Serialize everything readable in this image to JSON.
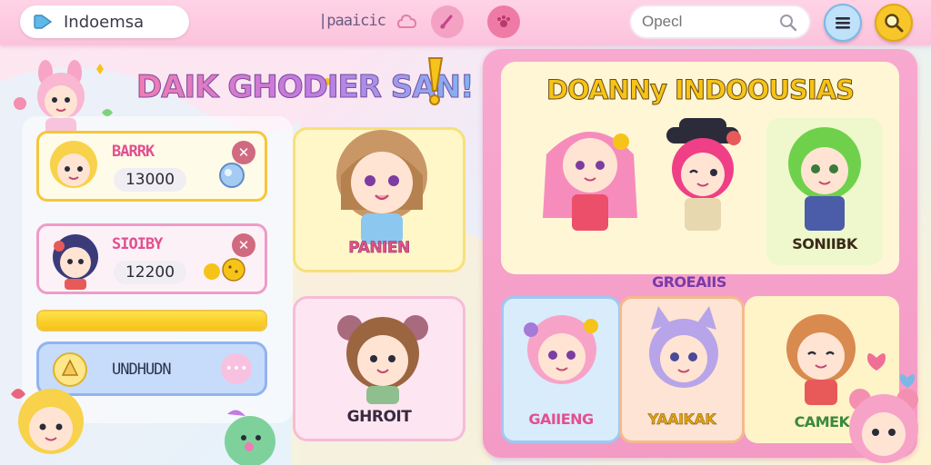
{
  "header": {
    "app_title": "Indoemsa",
    "nav_label": "|paaicic",
    "search_placeholder": "Opecl"
  },
  "left": {
    "big_title": "DAIK GHODIER SAN!",
    "players": [
      {
        "name": "BARRK",
        "score": "13000"
      },
      {
        "name": "SIOIBY",
        "score": "12200"
      }
    ],
    "progress_fraction": 1.0,
    "action_button": "UNDHUDN"
  },
  "middle": {
    "cards": [
      {
        "name": "PANIEN"
      },
      {
        "name": "GHROIT"
      }
    ]
  },
  "roster": {
    "title": "DOANNy INDOOUSIAS",
    "top_row": [
      {
        "name": "GROEAIIS"
      },
      {
        "name": ""
      },
      {
        "name": "SONIIBK"
      }
    ],
    "bottom_row": [
      {
        "name": "GAIIENG"
      },
      {
        "name": "YAAIKAK"
      },
      {
        "name": "CAMEK"
      }
    ]
  },
  "colors": {
    "accent_pink": "#f39ac5",
    "accent_yellow": "#f6c418",
    "accent_blue": "#91b4ee",
    "close_button": "#d06a80"
  },
  "icons": {
    "app_icon": "tag-icon",
    "search": "search-icon",
    "menu": "menu-icon",
    "magnifier_button": "magnifier-icon"
  }
}
